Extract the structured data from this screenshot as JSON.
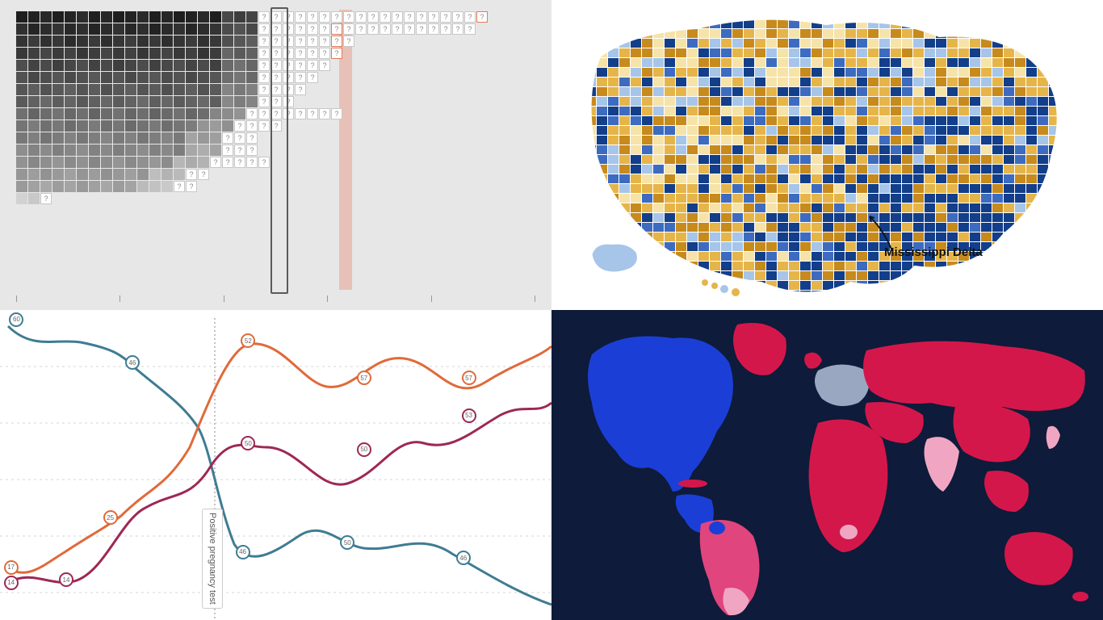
{
  "layout": "2x2 collage of four independent data-visualization panels",
  "panels": {
    "top_left": {
      "type": "cell-heatmap-timeline",
      "background": "#e7e7e7",
      "cell_known_fill_scale": "grayscale light-to-dark",
      "unknown_cell_glyph": "?",
      "unknown_cell_border": "#c7c7c7",
      "highlighted_cell_border": "#e37a5a",
      "cursor_column_index": 20,
      "shaded_column_index": 25,
      "row_count": 18,
      "known_cells_per_row": [
        20,
        20,
        20,
        20,
        20,
        20,
        20,
        20,
        19,
        18,
        17,
        17,
        16,
        14,
        13,
        2,
        0,
        0
      ],
      "unknown_cells_per_row": [
        19,
        18,
        8,
        7,
        6,
        5,
        4,
        3,
        8,
        4,
        3,
        3,
        5,
        2,
        2,
        1,
        0,
        0
      ],
      "marked_cell_positions": [
        {
          "row": 0,
          "col": 38
        },
        {
          "row": 1,
          "col": 26
        },
        {
          "row": 2,
          "col": 26
        },
        {
          "row": 3,
          "col": 26
        },
        {
          "row": 4,
          "col": 30
        },
        {
          "row": 5,
          "col": 27
        },
        {
          "row": 9,
          "col": 25
        },
        {
          "row": 12,
          "col": 24
        },
        {
          "row": 13,
          "col": 19
        },
        {
          "row": 14,
          "col": 18
        },
        {
          "row": 15,
          "col": 17
        }
      ],
      "axis_tick_count": 6
    },
    "top_right": {
      "type": "us-county-choropleth",
      "projection": "Albers USA",
      "color_scale": [
        "#123e8a",
        "#3d6bc0",
        "#a6c5e8",
        "#f6e3a9",
        "#e6b549",
        "#c78a1c"
      ],
      "annotation": {
        "text": "Mississippi Delta",
        "arrow_target_region": "lower-mississippi-river-counties"
      },
      "includes_alaska": true,
      "includes_hawaii": true,
      "dominant_color_eastern_south": "blue",
      "dominant_color_plains_west": "orange"
    },
    "bottom_left": {
      "type": "multi-line-chart",
      "event_marker": {
        "label": "Positive pregnancy test",
        "x_fraction": 0.39
      },
      "gridline_count": 5,
      "series": [
        {
          "name": "blue",
          "color": "#3f7c92",
          "points": [
            {
              "x": 0.03,
              "y": 0.03,
              "label": "60"
            },
            {
              "x": 0.24,
              "y": 0.17,
              "label": "46"
            },
            {
              "x": 0.44,
              "y": 0.78,
              "label": "46"
            },
            {
              "x": 0.63,
              "y": 0.75,
              "label": "50"
            },
            {
              "x": 0.84,
              "y": 0.8,
              "label": "46"
            }
          ]
        },
        {
          "name": "orange",
          "color": "#e06a3a",
          "points": [
            {
              "x": 0.02,
              "y": 0.83,
              "label": "17"
            },
            {
              "x": 0.2,
              "y": 0.67,
              "label": "25"
            },
            {
              "x": 0.45,
              "y": 0.1,
              "label": "52"
            },
            {
              "x": 0.66,
              "y": 0.22,
              "label": "57"
            },
            {
              "x": 0.85,
              "y": 0.22,
              "label": "57"
            }
          ]
        },
        {
          "name": "maroon",
          "color": "#9d2855",
          "points": [
            {
              "x": 0.02,
              "y": 0.88,
              "label": "14"
            },
            {
              "x": 0.12,
              "y": 0.87,
              "label": "14"
            },
            {
              "x": 0.45,
              "y": 0.43,
              "label": "50"
            },
            {
              "x": 0.66,
              "y": 0.45,
              "label": "50"
            },
            {
              "x": 0.85,
              "y": 0.34,
              "label": "53"
            }
          ]
        }
      ]
    },
    "bottom_right": {
      "type": "world-choropleth",
      "background": "#0e1b3a",
      "color_palette": {
        "blue": "#1b3fd6",
        "pink": "#e0457e",
        "crimson": "#d4174a",
        "lightpink": "#f0a6c2",
        "grey": "#9aa7c0"
      },
      "region_colors": {
        "north_america": "blue",
        "greenland": "crimson",
        "south_america": "pink",
        "argentina": "lightpink",
        "europe_west": "grey",
        "russia": "crimson",
        "africa": "crimson",
        "middle_east": "crimson",
        "india": "lightpink",
        "china": "crimson",
        "southeast_asia": "crimson",
        "australia": "crimson",
        "cuba": "crimson"
      }
    }
  }
}
